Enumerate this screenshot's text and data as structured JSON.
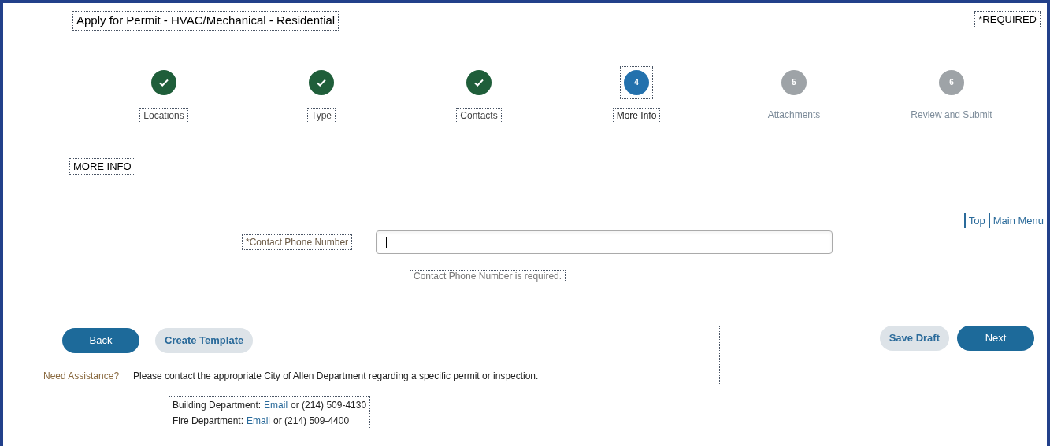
{
  "title": "Apply for Permit - HVAC/Mechanical - Residential",
  "required_note": "*REQUIRED",
  "steps": [
    {
      "label": "Locations",
      "completed": true,
      "selected": false
    },
    {
      "label": "Type",
      "completed": true,
      "selected": false
    },
    {
      "label": "Contacts",
      "completed": true,
      "selected": false
    },
    {
      "label": "More Info",
      "number": "4",
      "completed": false,
      "selected": true
    },
    {
      "label": "Attachments",
      "number": "5",
      "completed": false,
      "selected": false
    },
    {
      "label": "Review and Submit",
      "number": "6",
      "completed": false,
      "selected": false
    }
  ],
  "section_heading": "MORE INFO",
  "nav_links": [
    "Top",
    "Main Menu"
  ],
  "field": {
    "label": "*Contact Phone Number",
    "focused": true,
    "error": "Contact Phone Number is required."
  },
  "left_buttons": [
    {
      "label": "Back",
      "kind": "primary"
    },
    {
      "label": "Create Template",
      "kind": "secondary"
    }
  ],
  "right_buttons": [
    {
      "label": "Save Draft",
      "kind": "secondary"
    },
    {
      "label": "Next",
      "kind": "primary"
    }
  ],
  "assistance": {
    "label": "Need Assistance?",
    "text": "Please contact the appropriate City of Allen Department regarding a specific permit or inspection."
  },
  "contacts": [
    {
      "department": "Building Department:",
      "link": "Email",
      "phone": "or (214) 509-4130"
    },
    {
      "department": "Fire Department:",
      "link": "Email",
      "phone": "or (214) 509-4400"
    }
  ]
}
